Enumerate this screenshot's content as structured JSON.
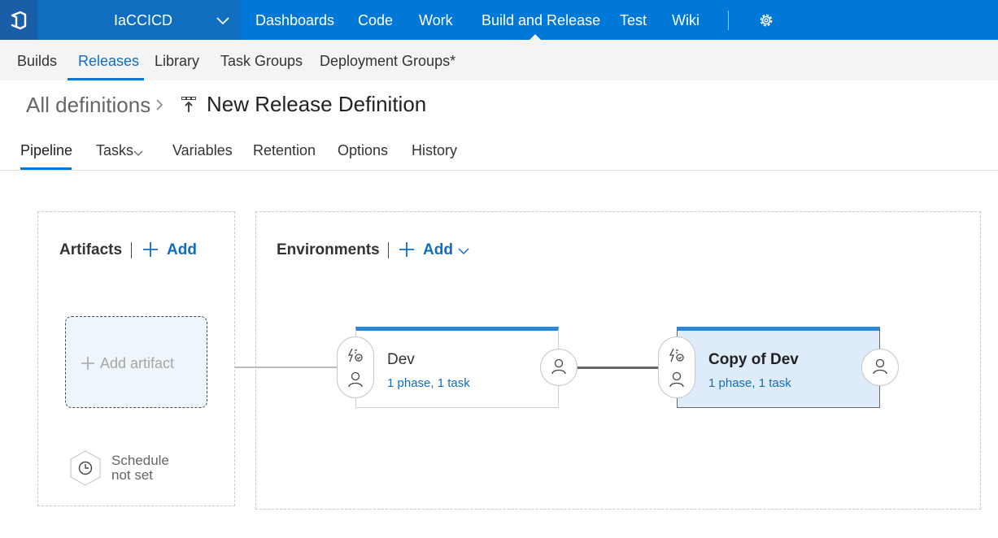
{
  "top_nav": {
    "project": "IaCCICD",
    "items": [
      "Dashboards",
      "Code",
      "Work",
      "Build and Release",
      "Test",
      "Wiki"
    ],
    "active": "Build and Release"
  },
  "hub_nav": {
    "items": [
      "Builds",
      "Releases",
      "Library",
      "Task Groups",
      "Deployment Groups*"
    ],
    "active": "Releases"
  },
  "breadcrumb": {
    "parent": "All definitions",
    "title": "New Release Definition"
  },
  "tabs": {
    "items": [
      "Pipeline",
      "Tasks",
      "Variables",
      "Retention",
      "Options",
      "History"
    ],
    "active": "Pipeline"
  },
  "artifacts": {
    "title": "Artifacts",
    "add_label": "Add",
    "add_artifact_label": "Add artifact",
    "schedule_line1": "Schedule",
    "schedule_line2": "not set"
  },
  "environments": {
    "title": "Environments",
    "add_label": "Add",
    "items": [
      {
        "name": "Dev",
        "summary": "1 phase, 1 task"
      },
      {
        "name": "Copy of Dev",
        "summary": "1 phase, 1 task"
      }
    ]
  },
  "colors": {
    "brand_blue": "#0078d7",
    "link_blue": "#106ebe",
    "selected_env_bg": "#deecf9"
  },
  "icons": [
    "vsts-logo-icon",
    "chevron-down-icon",
    "gear-icon",
    "chevron-right-icon",
    "release-definition-icon",
    "plus-icon",
    "clock-icon",
    "trigger-icon",
    "user-icon"
  ]
}
